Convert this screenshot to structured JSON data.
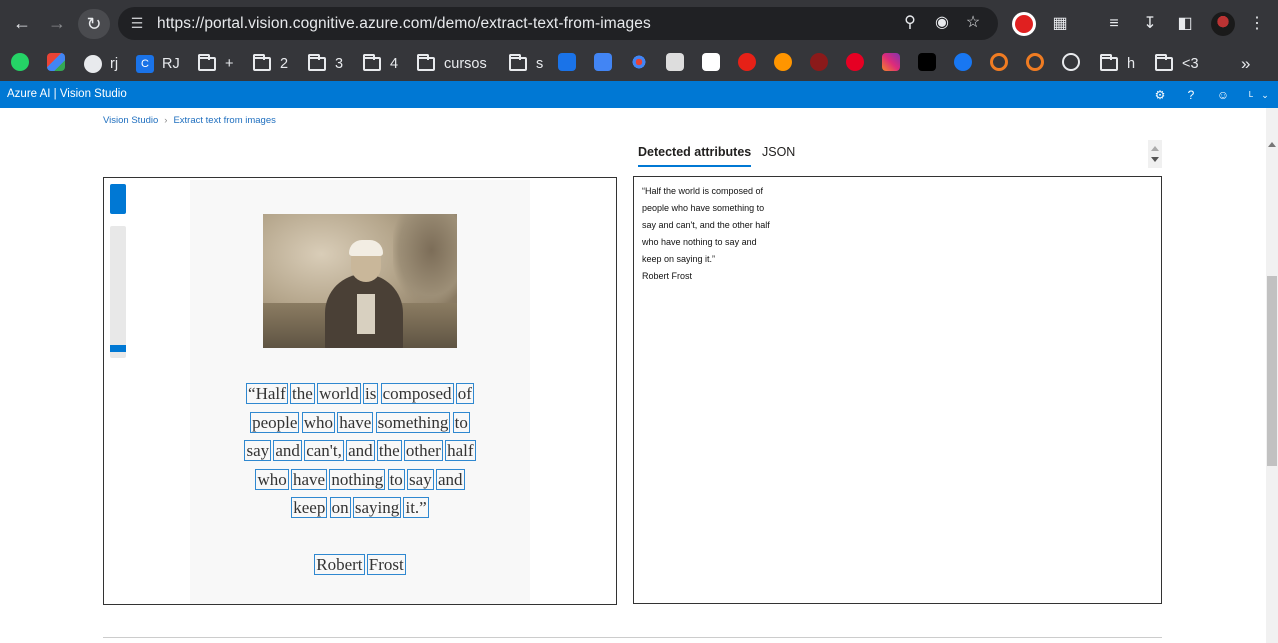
{
  "browser": {
    "url": "https://portal.vision.cognitive.azure.com/demo/extract-text-from-images",
    "icons": [
      "back-icon",
      "forward-icon",
      "reload-icon",
      "site-info-icon",
      "zoom-icon",
      "eye-off-icon",
      "star-icon",
      "stop-extension-icon",
      "puzzle-icon",
      "reading-list-icon",
      "download-icon",
      "side-panel-icon",
      "profile-avatar",
      "menu-icon"
    ]
  },
  "bookmarks": {
    "items": [
      {
        "label": "",
        "icon": "whatsapp-icon",
        "color": "#25d366"
      },
      {
        "label": "",
        "icon": "gmail-icon",
        "color": "#ea4335"
      },
      {
        "label": "rj",
        "icon": "globe-icon"
      },
      {
        "label": "RJ",
        "icon": "c-icon"
      },
      {
        "label": "+",
        "icon": "folder-icon"
      },
      {
        "label": "2",
        "icon": "folder-icon"
      },
      {
        "label": "3",
        "icon": "folder-icon"
      },
      {
        "label": "4",
        "icon": "folder-icon"
      },
      {
        "label": "cursos",
        "icon": "folder-icon"
      },
      {
        "label": "s",
        "icon": "folder-icon"
      },
      {
        "label": "h",
        "icon": "folder-icon"
      },
      {
        "label": "<3",
        "icon": "folder-icon"
      }
    ],
    "more": "»"
  },
  "azure": {
    "title": "Azure AI  |  Vision Studio",
    "user_initial": "L"
  },
  "breadcrumb": {
    "root": "Vision Studio",
    "separator": "›",
    "current": "Extract text from images"
  },
  "tabs": {
    "detected": "Detected attributes",
    "json": "JSON"
  },
  "image": {
    "lines": [
      [
        "“Half",
        "the",
        "world",
        "is",
        "composed",
        "of"
      ],
      [
        "people",
        "who",
        "have",
        "something",
        "to"
      ],
      [
        "say",
        "and",
        "can't,",
        "and",
        "the",
        "other",
        "half"
      ],
      [
        "who",
        "have",
        "nothing",
        "to",
        "say",
        "and"
      ],
      [
        "keep",
        "on",
        "saying",
        "it.”"
      ]
    ],
    "author": [
      "Robert",
      "Frost"
    ]
  },
  "result": {
    "lines": [
      "“Half the world is composed of",
      "people who have something to",
      "say and can't, and the other half",
      "who have nothing to say and",
      "keep on saying it.”",
      "Robert Frost"
    ]
  }
}
